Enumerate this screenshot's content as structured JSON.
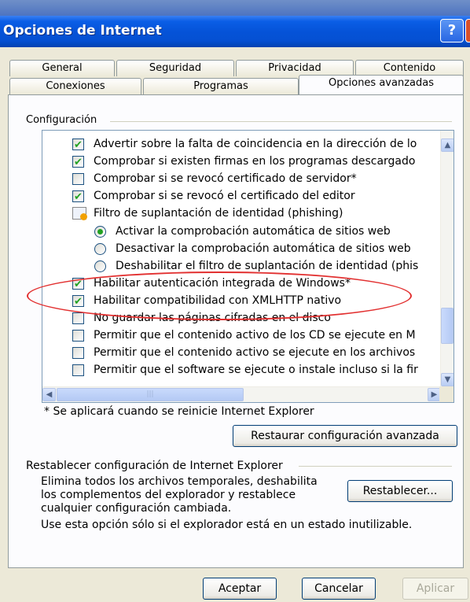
{
  "window": {
    "title": "Opciones de Internet",
    "help_glyph": "?",
    "close_glyph": "X"
  },
  "tabs_row1": [
    "General",
    "Seguridad",
    "Privacidad",
    "Contenido"
  ],
  "tabs_row2": [
    "Conexiones",
    "Programas",
    "Opciones avanzadas"
  ],
  "config": {
    "label": "Configuración",
    "items": [
      {
        "kind": "checkbox",
        "checked": true,
        "label": "Advertir sobre la falta de coincidencia en la dirección de lo"
      },
      {
        "kind": "checkbox",
        "checked": true,
        "label": "Comprobar si existen firmas en los programas descargado"
      },
      {
        "kind": "checkbox",
        "checked": false,
        "label": "Comprobar si se revocó certificado de servidor*"
      },
      {
        "kind": "checkbox",
        "checked": true,
        "label": "Comprobar si se revocó el certificado del editor"
      },
      {
        "kind": "group",
        "label": "Filtro de suplantación de identidad (phishing)"
      },
      {
        "kind": "radio",
        "checked": true,
        "label": "Activar la comprobación automática de sitios web"
      },
      {
        "kind": "radio",
        "checked": false,
        "label": "Desactivar la comprobación automática de sitios web"
      },
      {
        "kind": "radio",
        "checked": false,
        "label": "Deshabilitar el filtro de suplantación de identidad (phis"
      },
      {
        "kind": "checkbox",
        "checked": true,
        "label": "Habilitar autenticación integrada de Windows*"
      },
      {
        "kind": "checkbox",
        "checked": true,
        "label": "Habilitar compatibilidad con XMLHTTP nativo"
      },
      {
        "kind": "checkbox",
        "checked": false,
        "label": "No guardar las páginas cifradas en el disco"
      },
      {
        "kind": "checkbox",
        "checked": false,
        "label": "Permitir que el contenido activo de los CD se ejecute en M"
      },
      {
        "kind": "checkbox",
        "checked": false,
        "label": "Permitir que el contenido activo se ejecute en los archivos"
      },
      {
        "kind": "checkbox",
        "checked": false,
        "label": "Permitir que el software se ejecute o instale incluso si la fir"
      }
    ],
    "note": "* Se aplicará cuando se reinicie Internet Explorer",
    "restore_button": "Restaurar configuración avanzada"
  },
  "reset": {
    "label": "Restablecer configuración de Internet Explorer",
    "desc1": "Elimina todos los archivos temporales, deshabilita",
    "desc2": "los complementos del explorador y restablece",
    "desc3": "cualquier configuración cambiada.",
    "desc4": "Use esta opción sólo si el explorador está en un estado inutilizable.",
    "button": "Restablecer..."
  },
  "footer": {
    "ok": "Aceptar",
    "cancel": "Cancelar",
    "apply": "Aplicar"
  },
  "highlight_color": "#E23030"
}
